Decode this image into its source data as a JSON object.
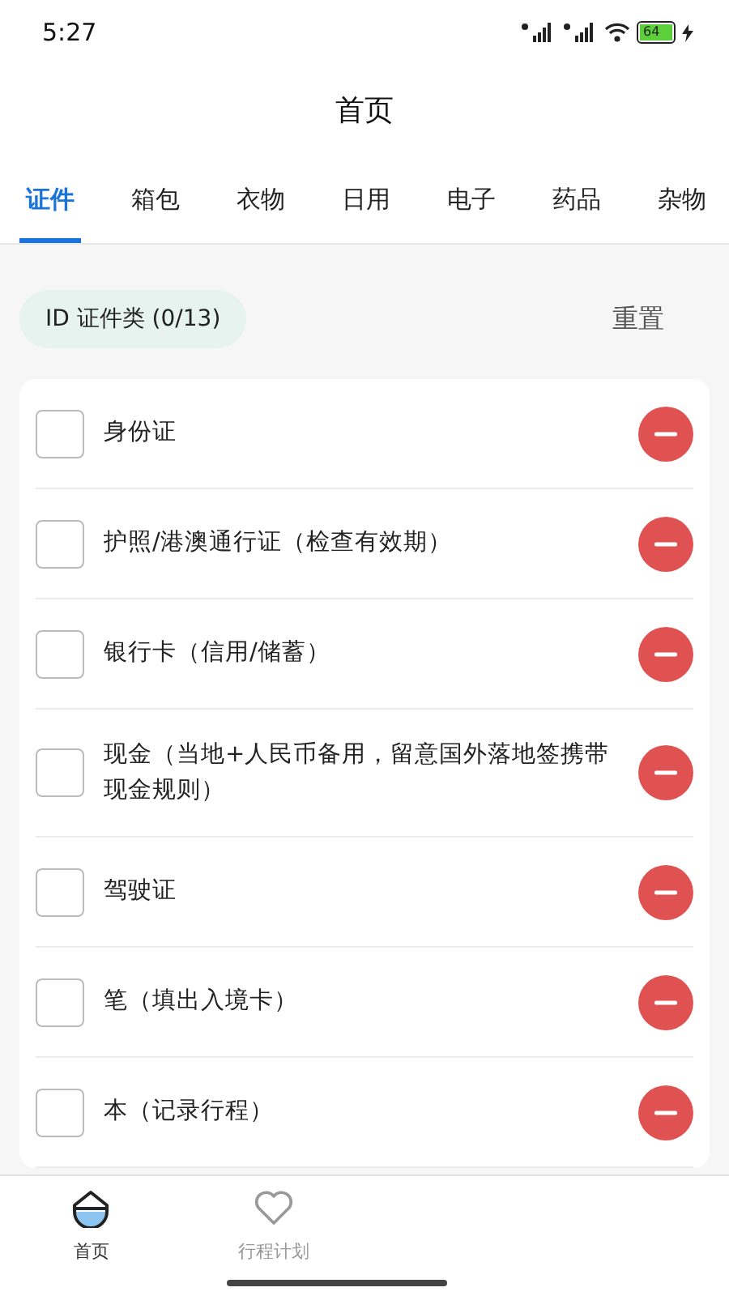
{
  "status_bar": {
    "time": "5:27",
    "battery": "64"
  },
  "header": {
    "title": "首页"
  },
  "tabs": [
    {
      "label": "证件",
      "selected": true
    },
    {
      "label": "箱包",
      "selected": false
    },
    {
      "label": "衣物",
      "selected": false
    },
    {
      "label": "日用",
      "selected": false
    },
    {
      "label": "电子",
      "selected": false
    },
    {
      "label": "药品",
      "selected": false
    },
    {
      "label": "杂物",
      "selected": false
    }
  ],
  "category": {
    "label": "ID 证件类 (0/13)",
    "reset": "重置"
  },
  "items": [
    {
      "text": "身份证",
      "checked": false
    },
    {
      "text": "护照/港澳通行证（检查有效期）",
      "checked": false
    },
    {
      "text": "银行卡（信用/储蓄）",
      "checked": false
    },
    {
      "text": "现金（当地+人民币备用，留意国外落地签携带现金规则）",
      "checked": false
    },
    {
      "text": "驾驶证",
      "checked": false
    },
    {
      "text": "笔（填出入境卡）",
      "checked": false
    },
    {
      "text": "本（记录行程）",
      "checked": false
    }
  ],
  "bottom_nav": [
    {
      "label": "首页",
      "selected": true
    },
    {
      "label": "行程计划",
      "selected": false
    }
  ]
}
